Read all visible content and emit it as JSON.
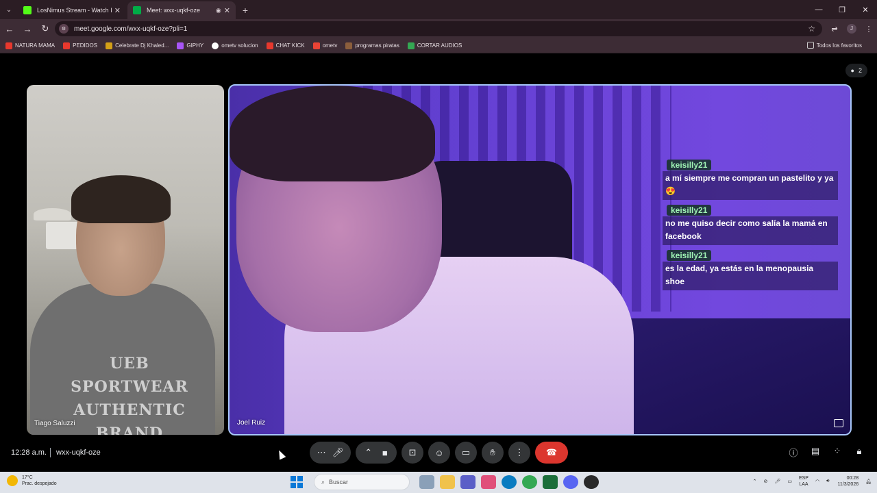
{
  "browser": {
    "tabs": [
      {
        "label": "LosNimus Stream - Watch Live",
        "active": false,
        "favicon_color": "#53fc18"
      },
      {
        "label": "Meet: wxx-uqkf-oze",
        "active": true,
        "favicon_color": "#00ac47"
      }
    ],
    "url": "meet.google.com/wxx-uqkf-oze?pli=1",
    "bookmarks": [
      {
        "label": "NATURA MAMA",
        "color": "#e8382d"
      },
      {
        "label": "PEDIDOS",
        "color": "#e8382d"
      },
      {
        "label": "Celebrate Dj Khaled...",
        "color": "#d4a017"
      },
      {
        "label": "GIPHY",
        "color": "#a855f7"
      },
      {
        "label": "ometv solucion",
        "color": "#ffffff"
      },
      {
        "label": "CHAT KICK",
        "color": "#e8382d"
      },
      {
        "label": "ometv",
        "color": "#ea4335"
      },
      {
        "label": "programas piratas",
        "color": "#8b5e3c"
      },
      {
        "label": "CORTAR AUDIOS",
        "color": "#34a853"
      }
    ],
    "all_bookmarks": "Todos los favoritos"
  },
  "meet": {
    "participants_count": "2",
    "left_tile": {
      "name": "Tiago Saluzzi",
      "shirt_text": "UEB SPORTWEAR AUTHENTIC BRAND"
    },
    "main_tile": {
      "name": "Joel Ruiz"
    },
    "chat": [
      {
        "user": "keisilly21",
        "text": "a mí siempre me compran un pastelito y ya 😍"
      },
      {
        "user": "keisilly21",
        "text": "no me quiso decir como salía la mamá en facebook"
      },
      {
        "user": "keisilly21",
        "text": "es la edad, ya estás en la menopausia shoe"
      }
    ],
    "time": "12:28 a.m.",
    "meeting_code": "wxx-uqkf-oze"
  },
  "taskbar": {
    "weather_temp": "17°C",
    "weather_desc": "Prac. despejado",
    "search_placeholder": "Buscar",
    "lang": "ESP",
    "lang_sub": "LAA",
    "clock_time": "00:28",
    "clock_date": "11/3/2026"
  },
  "colors": {
    "accent_border": "#a8c7fa",
    "end_call": "#dc362e",
    "chat_username": "#9ff3b4"
  }
}
